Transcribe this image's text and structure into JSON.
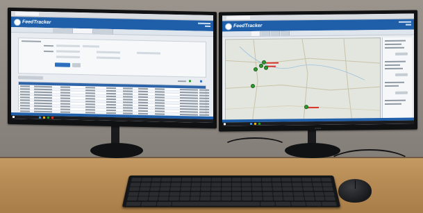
{
  "scene": {
    "app_name": "FeedTracker",
    "left_monitor": {
      "brand": "",
      "view": "search-results-table",
      "footer_text": ""
    },
    "right_monitor": {
      "brand": "ASUS",
      "view": "map-tracking"
    }
  },
  "colors": {
    "app_header": "#1f5fa9",
    "gps_pin": "#2e9a2e",
    "gps_trail": "#d9342b",
    "desk": "#c49a63",
    "wall": "#9a948d"
  },
  "icons": [
    "feedtracker-logo-icon",
    "gps-pin-icon",
    "keyboard-icon",
    "mouse-icon",
    "taskbar-start-icon"
  ]
}
